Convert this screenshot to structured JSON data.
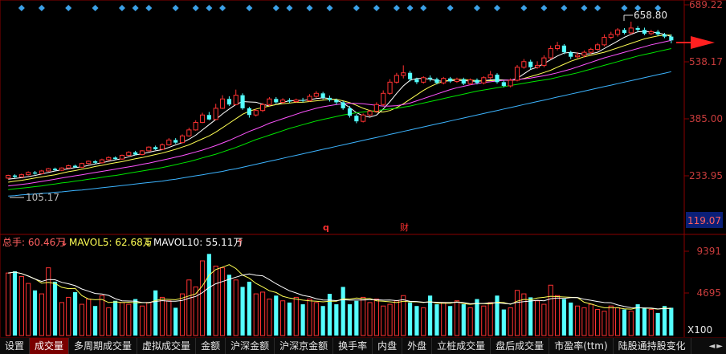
{
  "colors": {
    "up": "#ff3232",
    "down": "#54ffff",
    "ma5": "#ffffff",
    "ma10": "#ffff54",
    "ma20": "#ff54ff",
    "ma30": "#00e600",
    "ma60": "#3cb4ff",
    "axis_label": "#c83c3c",
    "indicator_label": "#ff6060",
    "mavol5": "#ffff54",
    "mavol10": "#ffffff"
  },
  "price_axis": {
    "labels": [
      "689.22",
      "538.17",
      "385.00",
      "233.95"
    ],
    "highlight": "119.07"
  },
  "annotations": {
    "high": "658.80",
    "low": "105.17",
    "marker_q": "q",
    "marker_cai": "财"
  },
  "volume_axis": {
    "labels": [
      "9391",
      "4695"
    ],
    "unit": "X100"
  },
  "indicator": {
    "total_label": "总手: 60.46万",
    "total_arrow": "↓",
    "mavol5_label": "MAVOL5: 62.68万",
    "mavol5_arrow": "↓",
    "mavol10_label": "MAVOL10: 55.11万",
    "mavol10_arrow": "↑"
  },
  "tabs": [
    {
      "label": "设置",
      "active": false
    },
    {
      "label": "成交量",
      "active": true
    },
    {
      "label": "多周期成交量",
      "active": false
    },
    {
      "label": "虚拟成交量",
      "active": false
    },
    {
      "label": "金额",
      "active": false
    },
    {
      "label": "沪深金额",
      "active": false
    },
    {
      "label": "沪深京金额",
      "active": false
    },
    {
      "label": "换手率",
      "active": false
    },
    {
      "label": "内盘",
      "active": false
    },
    {
      "label": "外盘",
      "active": false
    },
    {
      "label": "立桩成交量",
      "active": false
    },
    {
      "label": "盘后成交量",
      "active": false
    },
    {
      "label": "市盈率(ttm)",
      "active": false
    },
    {
      "label": "陆股通持股变化",
      "active": false
    }
  ],
  "tab_arrows": {
    "left": "◄",
    "right": "►"
  },
  "price_chart": {
    "ymin": 105,
    "ymax": 690,
    "candles": [
      [
        243,
        250,
        240,
        252
      ],
      [
        250,
        246,
        243,
        253
      ],
      [
        246,
        252,
        244,
        255
      ],
      [
        252,
        258,
        250,
        261
      ],
      [
        258,
        255,
        252,
        262
      ],
      [
        255,
        262,
        253,
        265
      ],
      [
        262,
        268,
        260,
        270
      ],
      [
        268,
        264,
        262,
        271
      ],
      [
        264,
        270,
        262,
        272
      ],
      [
        270,
        276,
        268,
        279
      ],
      [
        276,
        272,
        270,
        279
      ],
      [
        272,
        282,
        270,
        284
      ],
      [
        282,
        288,
        280,
        290
      ],
      [
        288,
        284,
        281,
        291
      ],
      [
        284,
        292,
        282,
        295
      ],
      [
        292,
        298,
        290,
        301
      ],
      [
        298,
        294,
        292,
        301
      ],
      [
        294,
        304,
        292,
        306
      ],
      [
        304,
        312,
        302,
        315
      ],
      [
        312,
        306,
        304,
        316
      ],
      [
        306,
        316,
        304,
        318
      ],
      [
        316,
        326,
        314,
        328
      ],
      [
        326,
        320,
        318,
        330
      ],
      [
        320,
        332,
        318,
        336
      ],
      [
        332,
        345,
        330,
        350
      ],
      [
        345,
        338,
        335,
        350
      ],
      [
        338,
        356,
        336,
        360
      ],
      [
        356,
        372,
        354,
        378
      ],
      [
        372,
        392,
        370,
        398
      ],
      [
        392,
        412,
        390,
        418
      ],
      [
        412,
        400,
        398,
        420
      ],
      [
        400,
        430,
        398,
        442
      ],
      [
        430,
        455,
        428,
        465
      ],
      [
        455,
        440,
        436,
        462
      ],
      [
        440,
        465,
        438,
        480
      ],
      [
        465,
        430,
        426,
        470
      ],
      [
        430,
        412,
        405,
        434
      ],
      [
        412,
        424,
        408,
        428
      ],
      [
        424,
        440,
        420,
        444
      ],
      [
        440,
        455,
        436,
        460
      ],
      [
        455,
        446,
        442,
        460
      ],
      [
        446,
        452,
        442,
        457
      ],
      [
        452,
        448,
        444,
        457
      ],
      [
        448,
        452,
        444,
        456
      ],
      [
        452,
        450,
        446,
        458
      ],
      [
        450,
        462,
        448,
        468
      ],
      [
        462,
        470,
        458,
        476
      ],
      [
        470,
        458,
        454,
        474
      ],
      [
        458,
        452,
        448,
        464
      ],
      [
        452,
        446,
        440,
        456
      ],
      [
        446,
        430,
        426,
        450
      ],
      [
        430,
        410,
        405,
        436
      ],
      [
        410,
        395,
        390,
        414
      ],
      [
        395,
        412,
        392,
        416
      ],
      [
        412,
        422,
        408,
        426
      ],
      [
        422,
        440,
        418,
        446
      ],
      [
        440,
        470,
        436,
        478
      ],
      [
        470,
        500,
        466,
        508
      ],
      [
        500,
        518,
        496,
        525
      ],
      [
        518,
        525,
        510,
        545
      ],
      [
        525,
        508,
        502,
        530
      ],
      [
        508,
        500,
        495,
        512
      ],
      [
        500,
        512,
        496,
        516
      ],
      [
        512,
        508,
        502,
        518
      ],
      [
        508,
        498,
        494,
        512
      ],
      [
        498,
        510,
        494,
        514
      ],
      [
        510,
        502,
        498,
        514
      ],
      [
        502,
        508,
        498,
        512
      ],
      [
        508,
        496,
        492,
        512
      ],
      [
        496,
        506,
        492,
        510
      ],
      [
        506,
        498,
        494,
        510
      ],
      [
        498,
        512,
        494,
        516
      ],
      [
        512,
        520,
        508,
        530
      ],
      [
        520,
        500,
        496,
        524
      ],
      [
        500,
        490,
        486,
        504
      ],
      [
        490,
        505,
        486,
        510
      ],
      [
        505,
        540,
        502,
        546
      ],
      [
        540,
        555,
        536,
        562
      ],
      [
        555,
        540,
        534,
        560
      ],
      [
        540,
        545,
        536,
        556
      ],
      [
        545,
        565,
        540,
        572
      ],
      [
        565,
        590,
        562,
        598
      ],
      [
        590,
        598,
        585,
        608
      ],
      [
        598,
        580,
        575,
        602
      ],
      [
        580,
        568,
        562,
        584
      ],
      [
        568,
        572,
        564,
        580
      ],
      [
        572,
        580,
        566,
        585
      ],
      [
        580,
        588,
        575,
        592
      ],
      [
        588,
        600,
        584,
        605
      ],
      [
        600,
        620,
        596,
        628
      ],
      [
        620,
        628,
        615,
        635
      ],
      [
        628,
        640,
        622,
        645
      ],
      [
        640,
        632,
        628,
        645
      ],
      [
        632,
        645,
        628,
        662
      ],
      [
        645,
        640,
        634,
        650
      ],
      [
        640,
        630,
        626,
        646
      ],
      [
        630,
        635,
        626,
        640
      ],
      [
        635,
        628,
        624,
        640
      ],
      [
        628,
        622,
        618,
        632
      ],
      [
        622,
        612,
        604,
        628
      ]
    ],
    "ma_series": [
      {
        "name": "MA5",
        "color": "#ffffff",
        "values": [
          240,
          242,
          244,
          247,
          250,
          254,
          258,
          262,
          265,
          268,
          271,
          273,
          277,
          281,
          284,
          288,
          292,
          295,
          300,
          305,
          308,
          312,
          316,
          319,
          325,
          332,
          338,
          347,
          358,
          372,
          386,
          400,
          415,
          428,
          440,
          448,
          447,
          446,
          441,
          436,
          440,
          446,
          450,
          451,
          451,
          453,
          456,
          458,
          456,
          452,
          444,
          432,
          418,
          410,
          406,
          412,
          428,
          448,
          470,
          490,
          505,
          510,
          510,
          508,
          504,
          502,
          504,
          505,
          504,
          503,
          502,
          504,
          506,
          507,
          506,
          505,
          510,
          522,
          534,
          540,
          550,
          560,
          570,
          578,
          580,
          578,
          575,
          576,
          580,
          590,
          600,
          610,
          620,
          628,
          635,
          636,
          635,
          632,
          628,
          622
        ]
      },
      {
        "name": "MA10",
        "color": "#ffff54",
        "values": [
          232,
          235,
          237,
          240,
          243,
          246,
          249,
          252,
          256,
          260,
          263,
          267,
          270,
          274,
          277,
          281,
          284,
          287,
          291,
          295,
          298,
          302,
          306,
          310,
          315,
          320,
          326,
          332,
          340,
          348,
          356,
          366,
          378,
          390,
          402,
          414,
          422,
          428,
          432,
          436,
          440,
          442,
          444,
          446,
          446,
          448,
          450,
          452,
          454,
          454,
          450,
          445,
          438,
          430,
          424,
          420,
          420,
          424,
          432,
          442,
          454,
          466,
          478,
          488,
          496,
          502,
          506,
          508,
          507,
          506,
          504,
          503,
          504,
          505,
          505,
          505,
          506,
          510,
          515,
          520,
          526,
          532,
          540,
          548,
          556,
          562,
          568,
          572,
          576,
          580,
          586,
          592,
          598,
          604,
          610,
          616,
          620,
          624,
          626,
          626
        ]
      },
      {
        "name": "MA20",
        "color": "#ff54ff",
        "values": [
          222,
          224,
          226,
          228,
          231,
          234,
          237,
          240,
          243,
          246,
          249,
          252,
          255,
          258,
          261,
          264,
          267,
          270,
          273,
          276,
          280,
          283,
          287,
          291,
          295,
          299,
          303,
          308,
          313,
          318,
          324,
          330,
          337,
          344,
          352,
          360,
          368,
          375,
          382,
          390,
          396,
          402,
          408,
          414,
          420,
          425,
          430,
          434,
          437,
          440,
          442,
          443,
          443,
          442,
          440,
          438,
          436,
          436,
          437,
          440,
          444,
          450,
          456,
          462,
          468,
          474,
          480,
          485,
          489,
          493,
          496,
          499,
          501,
          503,
          505,
          506,
          507,
          509,
          511,
          514,
          517,
          521,
          525,
          530,
          535,
          541,
          547,
          553,
          559,
          565,
          570,
          575,
          580,
          585,
          590,
          595,
          600,
          604,
          608,
          612
        ]
      },
      {
        "name": "MA30",
        "color": "#00e600",
        "values": [
          212,
          214,
          216,
          218,
          220,
          222,
          225,
          227,
          230,
          232,
          235,
          237,
          240,
          242,
          245,
          248,
          250,
          253,
          256,
          259,
          262,
          265,
          268,
          271,
          275,
          279,
          283,
          287,
          292,
          297,
          302,
          307,
          313,
          319,
          325,
          332,
          339,
          346,
          352,
          358,
          364,
          370,
          376,
          381,
          386,
          391,
          396,
          400,
          404,
          408,
          412,
          415,
          418,
          420,
          422,
          424,
          426,
          428,
          430,
          433,
          436,
          440,
          444,
          448,
          452,
          456,
          460,
          464,
          468,
          472,
          476,
          479,
          482,
          485,
          488,
          491,
          494,
          497,
          500,
          503,
          506,
          509,
          513,
          517,
          521,
          525,
          530,
          535,
          540,
          545,
          550,
          555,
          560,
          565,
          570,
          574,
          578,
          582,
          586,
          590
        ]
      },
      {
        "name": "MA60",
        "color": "#3cb4ff",
        "values": [
          195,
          196,
          198,
          199,
          200,
          202,
          203,
          205,
          206,
          208,
          210,
          211,
          213,
          215,
          217,
          219,
          221,
          223,
          225,
          227,
          229,
          231,
          233,
          235,
          238,
          240,
          243,
          246,
          249,
          252,
          255,
          258,
          261,
          265,
          268,
          272,
          276,
          280,
          284,
          288,
          292,
          296,
          300,
          304,
          308,
          312,
          316,
          320,
          324,
          328,
          332,
          336,
          340,
          344,
          348,
          352,
          356,
          360,
          364,
          368,
          372,
          376,
          380,
          384,
          388,
          392,
          396,
          400,
          404,
          408,
          412,
          416,
          420,
          424,
          428,
          432,
          436,
          440,
          444,
          448,
          452,
          456,
          460,
          464,
          468,
          472,
          476,
          480,
          484,
          488,
          492,
          496,
          500,
          504,
          508,
          512,
          516,
          520,
          524,
          528
        ]
      }
    ],
    "top_markers": [
      2,
      5,
      9,
      13,
      17,
      19,
      21,
      25,
      28,
      30,
      32,
      36,
      40,
      42,
      45,
      48,
      52,
      55,
      58,
      60,
      62,
      66,
      70,
      73,
      77,
      80,
      83,
      86,
      88,
      92,
      94,
      97
    ]
  },
  "volume_chart": {
    "ymax": 9800,
    "values": [
      7200,
      7400,
      6800,
      6000,
      5200,
      4800,
      7800,
      6200,
      3800,
      4400,
      5000,
      3600,
      4200,
      3400,
      4600,
      3200,
      4000,
      3800,
      3600,
      4200,
      3400,
      3800,
      5200,
      4400,
      4000,
      3200,
      4800,
      6400,
      5600,
      8600,
      9400,
      8000,
      7800,
      7000,
      6400,
      5600,
      6200,
      4800,
      5000,
      4200,
      4600,
      4000,
      3800,
      4400,
      3600,
      4200,
      3800,
      3400,
      4800,
      3600,
      5600,
      3600,
      4000,
      4400,
      3800,
      4200,
      3400,
      3600,
      4000,
      4600,
      3800,
      3400,
      3200,
      4600,
      3600,
      3800,
      3400,
      4000,
      3600,
      3200,
      4200,
      3400,
      3800,
      4600,
      3000,
      3200,
      5200,
      4800,
      4400,
      4000,
      3600,
      5800,
      4600,
      4200,
      3800,
      3400,
      3200,
      3600,
      3000,
      2800,
      3400,
      3200,
      3000,
      2800,
      3600,
      3200,
      3000,
      2600,
      3400,
      3200
    ]
  }
}
